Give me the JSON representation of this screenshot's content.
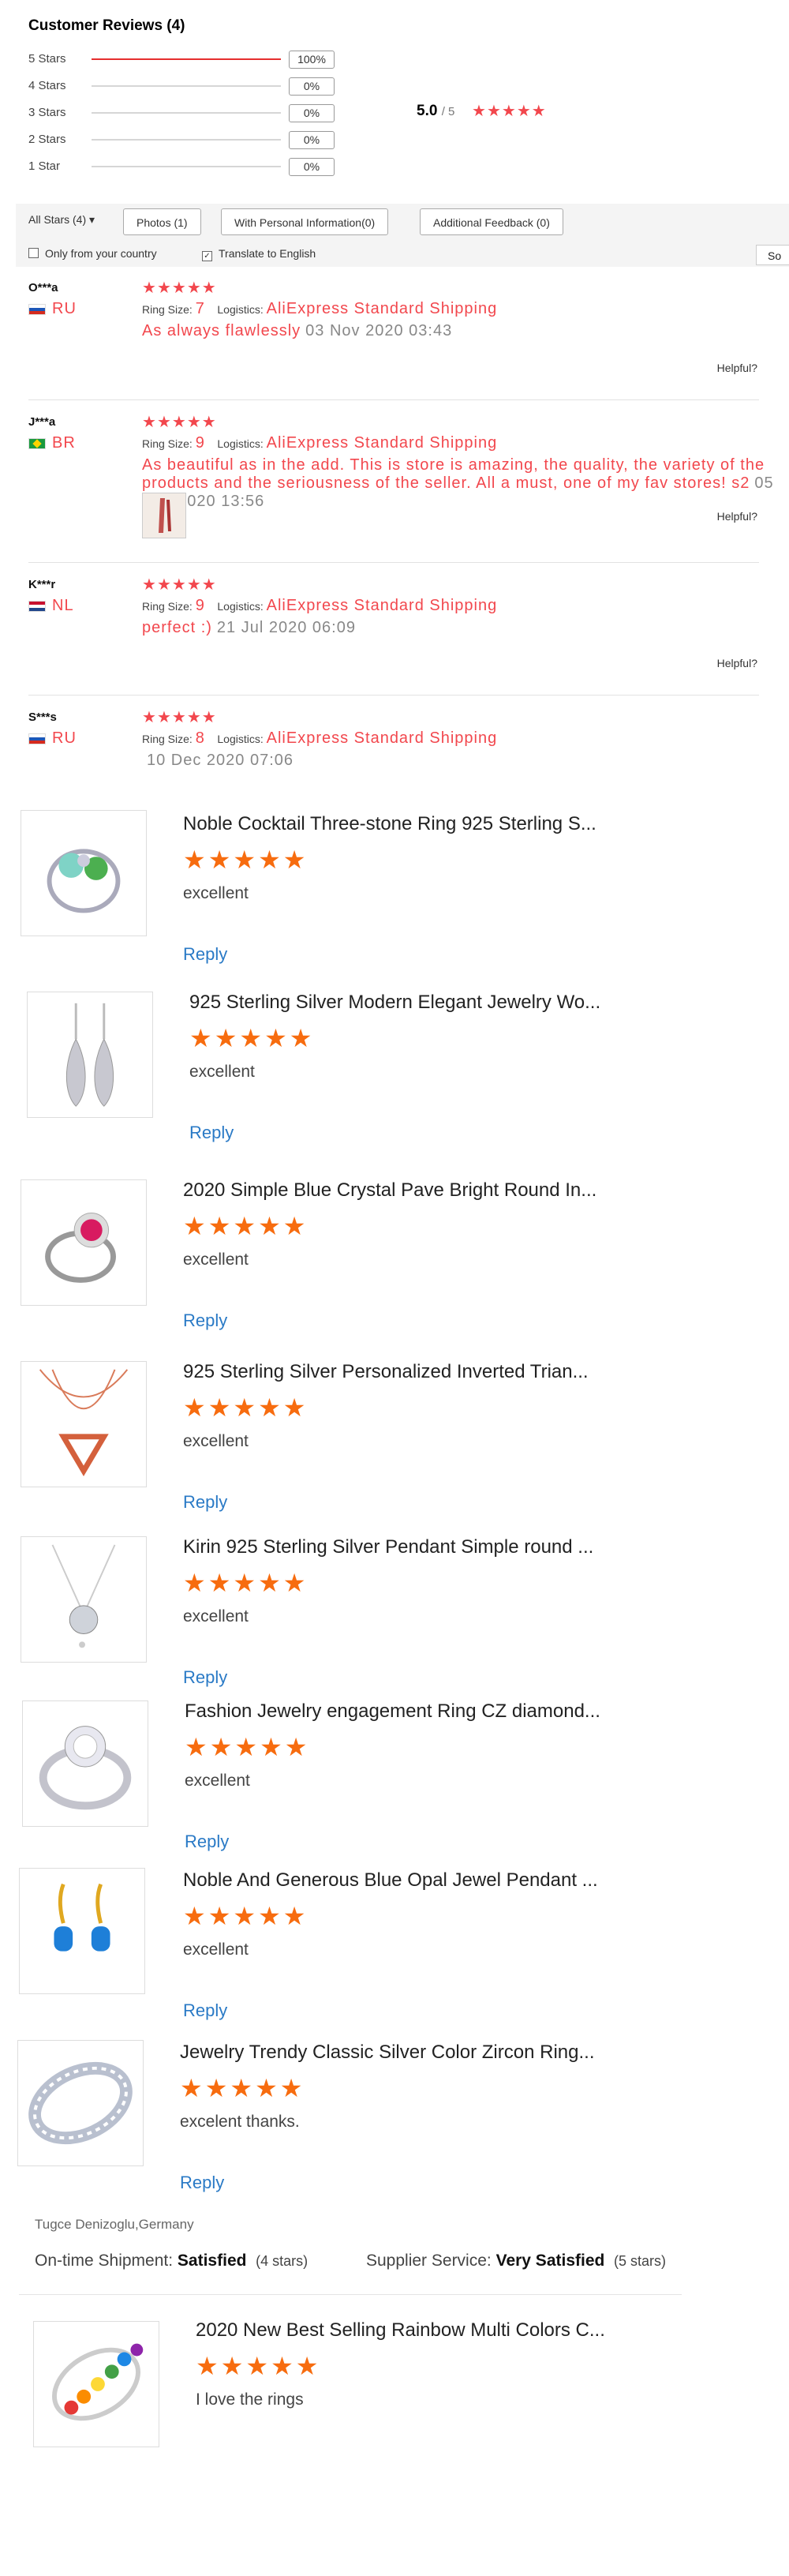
{
  "reviews_header": {
    "title": "Customer Reviews (4)",
    "histogram": [
      {
        "label": "5 Stars",
        "percent": "100%",
        "fill": 1.0
      },
      {
        "label": "4 Stars",
        "percent": "0%",
        "fill": 0
      },
      {
        "label": "3 Stars",
        "percent": "0%",
        "fill": 0
      },
      {
        "label": "2 Stars",
        "percent": "0%",
        "fill": 0
      },
      {
        "label": "1 Star",
        "percent": "0%",
        "fill": 0
      }
    ],
    "average": "5.0",
    "average_suffix": "/ 5",
    "average_stars": 5
  },
  "filters": {
    "dropdown": "All Stars (4) ▾",
    "buttons": [
      "Photos (1)",
      "With Personal Information(0)",
      "Additional Feedback (0)"
    ],
    "only_country": "Only from your country",
    "translate": "Translate to English",
    "translate_checked": true,
    "sort": "So"
  },
  "colors": {
    "red_star": "#f2474d",
    "orange_star": "#f76c0f",
    "link_blue": "#2a7ac6"
  },
  "reviews": [
    {
      "user": "O***a",
      "country": "RU",
      "flag": "ru",
      "stars": 5,
      "ring_size_label": "Ring Size:",
      "ring_size": "7",
      "logistics_label": "Logistics:",
      "logistics": "AliExpress Standard Shipping",
      "text": "As always flawlessly",
      "date": "03 Nov 2020 03:43",
      "helpful": "Helpful?"
    },
    {
      "user": "J***a",
      "country": "BR",
      "flag": "br",
      "stars": 5,
      "ring_size_label": "Ring Size:",
      "ring_size": "9",
      "logistics_label": "Logistics:",
      "logistics": "AliExpress Standard Shipping",
      "text": "As beautiful as in the add. This is store is amazing, the quality, the variety of the products and the seriousness of the seller. All a must, one of my fav stores! s2",
      "date": "05 Aug 2020 13:56",
      "helpful": "Helpful?",
      "has_photo": true
    },
    {
      "user": "K***r",
      "country": "NL",
      "flag": "nl",
      "stars": 5,
      "ring_size_label": "Ring Size:",
      "ring_size": "9",
      "logistics_label": "Logistics:",
      "logistics": "AliExpress Standard Shipping",
      "text": "perfect :)",
      "date": "21 Jul 2020 06:09",
      "helpful": "Helpful?"
    },
    {
      "user": "S***s",
      "country": "RU",
      "flag": "ru",
      "stars": 5,
      "ring_size_label": "Ring Size:",
      "ring_size": "8",
      "logistics_label": "Logistics:",
      "logistics": "AliExpress Standard Shipping",
      "text": "",
      "date": "10 Dec 2020 07:06"
    }
  ],
  "product_reviews": [
    {
      "name": "Noble Cocktail Three-stone Ring 925 Sterling S...",
      "stars": 5,
      "text": "excellent",
      "reply": "Reply",
      "image_icon": "ring-three-stone"
    },
    {
      "name": "925 Sterling Silver Modern Elegant Jewelry Wo...",
      "stars": 5,
      "text": "excellent",
      "reply": "Reply",
      "image_icon": "drop-earrings"
    },
    {
      "name": "2020 Simple Blue Crystal Pave Bright Round In...",
      "stars": 5,
      "text": "excellent",
      "reply": "Reply",
      "image_icon": "halo-ring"
    },
    {
      "name": "925 Sterling Silver Personalized Inverted Trian...",
      "stars": 5,
      "text": "excellent",
      "reply": "Reply",
      "image_icon": "triangle-necklace"
    },
    {
      "name": "Kirin 925 Sterling Silver Pendant Simple round ...",
      "stars": 5,
      "text": "excellent",
      "reply": "Reply",
      "image_icon": "round-pendant"
    },
    {
      "name": "Fashion Jewelry engagement Ring CZ diamond...",
      "stars": 5,
      "text": "excellent",
      "reply": "Reply",
      "image_icon": "engagement-ring"
    },
    {
      "name": "Noble And Generous Blue Opal Jewel Pendant ...",
      "stars": 5,
      "text": "excellent",
      "reply": "Reply",
      "image_icon": "opal-earrings"
    },
    {
      "name": "Jewelry Trendy Classic Silver Color Zircon Ring...",
      "stars": 5,
      "text": "excelent thanks.",
      "reply": "Reply",
      "image_icon": "eternity-ring"
    }
  ],
  "seller_feedback": {
    "reviewer": "Tugce Denizoglu,Germany",
    "shipment_label": "On-time Shipment:",
    "shipment_value": "Satisfied",
    "shipment_stars": "(4 stars)",
    "service_label": "Supplier Service:",
    "service_value": "Very Satisfied",
    "service_stars": "(5 stars)"
  },
  "last_product": {
    "name": "2020 New Best Selling Rainbow Multi Colors C...",
    "stars": 5,
    "text": "I love the rings",
    "image_icon": "rainbow-ring"
  }
}
